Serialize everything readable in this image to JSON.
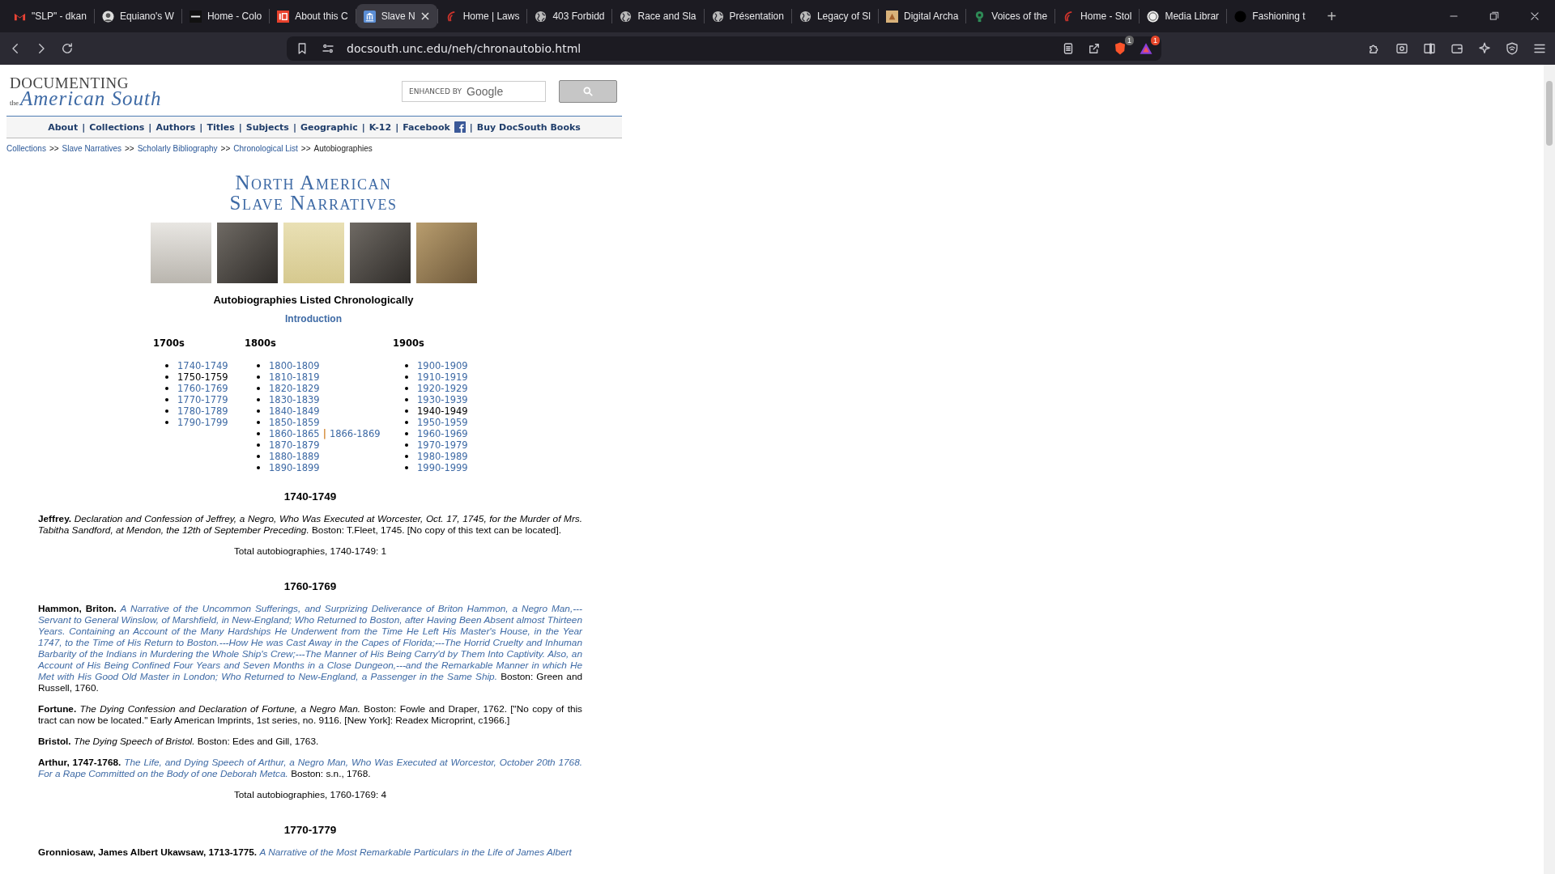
{
  "browser": {
    "tabs": [
      {
        "title": "\"SLP\" - dkan",
        "kind": "mail",
        "selected": false
      },
      {
        "title": "Equiano's W",
        "kind": "avatar",
        "selected": false
      },
      {
        "title": "Home - Colo",
        "kind": "dark-square",
        "selected": false
      },
      {
        "title": "About this C",
        "kind": "red-square",
        "selected": false
      },
      {
        "title": "Slave N",
        "kind": "building",
        "selected": true
      },
      {
        "title": "Home | Laws",
        "kind": "swirl",
        "selected": false
      },
      {
        "title": "403 Forbidd",
        "kind": "globe",
        "selected": false
      },
      {
        "title": "Race and Sla",
        "kind": "globe",
        "selected": false
      },
      {
        "title": "Présentation",
        "kind": "globe",
        "selected": false
      },
      {
        "title": "Legacy of Sl",
        "kind": "globe",
        "selected": false
      },
      {
        "title": "Digital Archa",
        "kind": "tan-square",
        "selected": false
      },
      {
        "title": "Voices of the",
        "kind": "green-pin",
        "selected": false
      },
      {
        "title": "Home - Stol",
        "kind": "swirl",
        "selected": false
      },
      {
        "title": "Media Librar",
        "kind": "white-circle",
        "selected": false
      },
      {
        "title": "Fashioning t",
        "kind": "black-circle",
        "selected": false
      }
    ],
    "new_tab": "+",
    "address": "docsouth.unc.edu/neh/chronautobio.html",
    "shield_badge": "1",
    "rewards_badge": "1"
  },
  "site": {
    "logo": {
      "top": "DOCUMENTING",
      "small": "the",
      "script": "American South"
    },
    "search": {
      "label": "ENHANCED BY",
      "brand": "Google"
    },
    "nav": {
      "items": [
        "About",
        "Collections",
        "Authors",
        "Titles",
        "Subjects",
        "Geographic",
        "K-12",
        "Facebook",
        "Buy DocSouth Books"
      ],
      "separator": "|"
    },
    "breadcrumb": {
      "items": [
        {
          "label": "Collections",
          "link": true
        },
        {
          "label": "Slave Narratives",
          "link": true
        },
        {
          "label": "Scholarly Bibliography",
          "link": true
        },
        {
          "label": "Chronological List",
          "link": true
        },
        {
          "label": "Autobiographies",
          "link": false
        }
      ],
      "separator": ">>"
    },
    "title_lines": [
      "North American",
      "Slave Narratives"
    ],
    "photos": [
      {
        "kind": "engraving"
      },
      {
        "kind": "photograph"
      },
      {
        "kind": "title-page"
      },
      {
        "kind": "photograph"
      },
      {
        "kind": "sepia"
      }
    ],
    "heading": "Autobiographies Listed Chronologically",
    "intro_link": "Introduction",
    "centuries": [
      {
        "label": "1700s",
        "items": [
          {
            "links": [
              {
                "label": "1740-1749",
                "link": true
              }
            ]
          },
          {
            "links": [
              {
                "label": "1750-1759",
                "link": false
              }
            ]
          },
          {
            "links": [
              {
                "label": "1760-1769",
                "link": true
              }
            ]
          },
          {
            "links": [
              {
                "label": "1770-1779",
                "link": true
              }
            ]
          },
          {
            "links": [
              {
                "label": "1780-1789",
                "link": true
              }
            ]
          },
          {
            "links": [
              {
                "label": "1790-1799",
                "link": true
              }
            ]
          }
        ]
      },
      {
        "label": "1800s",
        "items": [
          {
            "links": [
              {
                "label": "1800-1809",
                "link": true
              }
            ]
          },
          {
            "links": [
              {
                "label": "1810-1819",
                "link": true
              }
            ]
          },
          {
            "links": [
              {
                "label": "1820-1829",
                "link": true
              }
            ]
          },
          {
            "links": [
              {
                "label": "1830-1839",
                "link": true
              }
            ]
          },
          {
            "links": [
              {
                "label": "1840-1849",
                "link": true
              }
            ]
          },
          {
            "links": [
              {
                "label": "1850-1859",
                "link": true
              }
            ]
          },
          {
            "links": [
              {
                "label": "1860-1865",
                "link": true
              },
              {
                "label": "1866-1869",
                "link": true
              }
            ],
            "separator": "|"
          },
          {
            "links": [
              {
                "label": "1870-1879",
                "link": true
              }
            ]
          },
          {
            "links": [
              {
                "label": "1880-1889",
                "link": true
              }
            ]
          },
          {
            "links": [
              {
                "label": "1890-1899",
                "link": true
              }
            ]
          }
        ]
      },
      {
        "label": "1900s",
        "items": [
          {
            "links": [
              {
                "label": "1900-1909",
                "link": true
              }
            ]
          },
          {
            "links": [
              {
                "label": "1910-1919",
                "link": true
              }
            ]
          },
          {
            "links": [
              {
                "label": "1920-1929",
                "link": true
              }
            ]
          },
          {
            "links": [
              {
                "label": "1930-1939",
                "link": true
              }
            ]
          },
          {
            "links": [
              {
                "label": "1940-1949",
                "link": false
              }
            ]
          },
          {
            "links": [
              {
                "label": "1950-1959",
                "link": true
              }
            ]
          },
          {
            "links": [
              {
                "label": "1960-1969",
                "link": true
              }
            ]
          },
          {
            "links": [
              {
                "label": "1970-1979",
                "link": true
              }
            ]
          },
          {
            "links": [
              {
                "label": "1980-1989",
                "link": true
              }
            ]
          },
          {
            "links": [
              {
                "label": "1990-1999",
                "link": true
              }
            ]
          }
        ]
      }
    ],
    "sections": [
      {
        "heading": "1740-1749",
        "entries": [
          {
            "author": "Jeffrey.",
            "title": "Declaration and Confession of Jeffrey, a Negro, Who Was Executed at Worcester, Oct. 17, 1745, for the Murder of Mrs. Tabitha Sandford, at Mendon, the 12th of September Preceding.",
            "linked": false,
            "note": "Boston: T.Fleet, 1745. [No copy of this text can be located]."
          }
        ],
        "total": "Total autobiographies, 1740-1749: 1"
      },
      {
        "heading": "1760-1769",
        "entries": [
          {
            "author": "Hammon, Briton.",
            "title": "A Narrative of the Uncommon Sufferings, and Surprizing Deliverance of Briton Hammon, a Negro Man,---Servant to General Winslow, of Marshfield, in New-England; Who Returned to Boston, after Having Been Absent almost Thirteen Years. Containing an Account of the Many Hardships He Underwent from the Time He Left His Master's House, in the Year 1747, to the Time of His Return to Boston.---How He was Cast Away in the Capes of Florida;---The Horrid Cruelty and Inhuman Barbarity of the Indians in Murdering the Whole Ship's Crew;---The Manner of His Being Carry'd by Them Into Captivity. Also, an Account of His Being Confined Four Years and Seven Months in a Close Dungeon,---and the Remarkable Manner in which He Met with His Good Old Master in London; Who Returned to New-England, a Passenger in the Same Ship.",
            "linked": true,
            "note": "Boston: Green and Russell, 1760."
          },
          {
            "author": "Fortune.",
            "title": "The Dying Confession and Declaration of Fortune, a Negro Man.",
            "linked": false,
            "note": "Boston: Fowle and Draper, 1762. [\"No copy of this tract can now be located.\" Early American Imprints, 1st series, no. 9116. [New York]: Readex Microprint, c1966.]"
          },
          {
            "author": "Bristol.",
            "title": "The Dying Speech of Bristol.",
            "linked": false,
            "note": "Boston: Edes and Gill, 1763."
          },
          {
            "author": "Arthur, 1747-1768.",
            "title": "The Life, and Dying Speech of Arthur, a Negro Man, Who Was Executed at Worcestor, October 20th 1768. For a Rape Committed on the Body of one Deborah Metca.",
            "linked": true,
            "note": "Boston: s.n., 1768."
          }
        ],
        "total": "Total autobiographies, 1760-1769: 4"
      },
      {
        "heading": "1770-1779",
        "entries": [
          {
            "author": "Gronniosaw, James Albert Ukawsaw, 1713-1775.",
            "title": "A Narrative of the Most Remarkable Particulars in the Life of James Albert",
            "linked": true
          }
        ]
      }
    ]
  }
}
